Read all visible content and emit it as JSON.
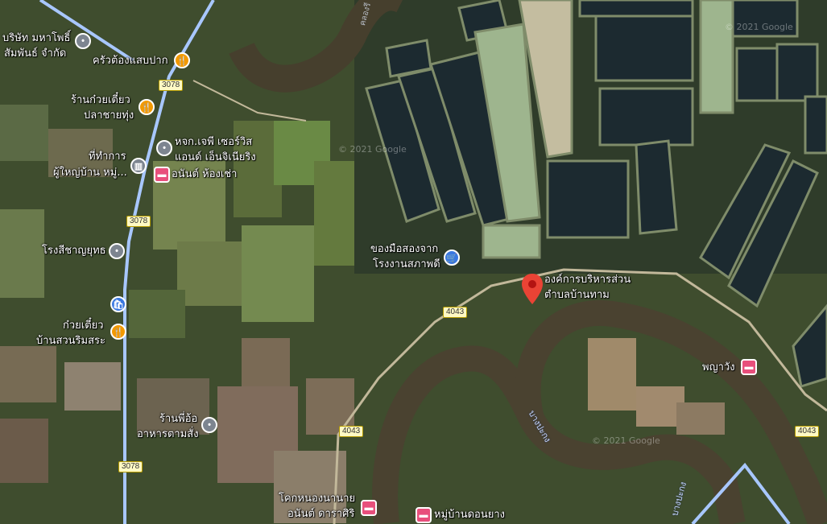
{
  "map": {
    "type": "satellite",
    "places": [
      {
        "id": "company",
        "lines": [
          "บริษัท มหาโพธิ์",
          "สัมพันธ์ จำกัด"
        ],
        "icon": "grey-pin-icon"
      },
      {
        "id": "kitchen",
        "lines": [
          "ครัวต้องแสบปาก"
        ],
        "icon": "restaurant-icon"
      },
      {
        "id": "noodle1",
        "lines": [
          "ร้านก๋วยเตี๋ยว",
          "ปลาชายทุ่ง"
        ],
        "icon": "restaurant-icon"
      },
      {
        "id": "service",
        "lines": [
          "หจก.เจพี เซอร์วิส",
          "แอนด์ เอ็นจิเนียริง"
        ],
        "icon": "grey-pin-icon"
      },
      {
        "id": "office",
        "lines": [
          "ที่ทำการ",
          "ผู้ใหญ่บ้าน หมู่..."
        ],
        "icon": "government-icon"
      },
      {
        "id": "room",
        "lines": [
          "อนันต์ ห้องเช่า"
        ],
        "icon": "hotel-icon"
      },
      {
        "id": "hospital",
        "lines": [
          "โรงสีชาญยุทธ"
        ],
        "icon": "grey-pin-icon"
      },
      {
        "id": "noodle2",
        "lines": [
          "ก๋วยเตี๋ยว",
          "บ้านสวนริมสระ"
        ],
        "icon": "restaurant-icon"
      },
      {
        "id": "secondhand",
        "lines": [
          "ของมือสองจาก",
          "โรงงานสภาพดี"
        ],
        "icon": "shopping-icon"
      },
      {
        "id": "admin",
        "lines": [
          "องค์การบริหารส่วน",
          "ตำบลบ้านทาม"
        ],
        "icon": "red-pin-icon"
      },
      {
        "id": "phaya",
        "lines": [
          "พญาวัง"
        ],
        "icon": "hotel-icon"
      },
      {
        "id": "food",
        "lines": [
          "ร้านพี่อ้อ",
          "อาหารตามสั่ง"
        ],
        "icon": "grey-pin-icon"
      },
      {
        "id": "khok",
        "lines": [
          "โคกหนองนานาย",
          "อนันต์ ดาราศิริ"
        ],
        "icon": "hotel-icon"
      },
      {
        "id": "village",
        "lines": [
          "หมู่บ้านดอนยาง"
        ],
        "icon": "hotel-icon"
      }
    ],
    "roads": [
      "3078",
      "3078",
      "3078",
      "4043",
      "4043",
      "4043"
    ],
    "rivers": [
      "บางปะกง",
      "บางปะกง"
    ],
    "canal": "คลองรี",
    "copyright": [
      "© 2021 Google",
      "© 2021 Google",
      "© 2021 Google"
    ]
  }
}
